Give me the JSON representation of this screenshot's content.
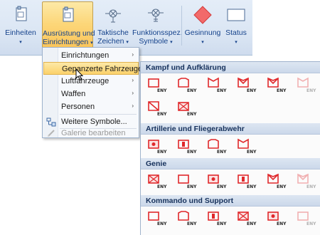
{
  "ribbon": {
    "buttons": [
      {
        "id": "einheiten",
        "line1": "Einheiten",
        "line2": "",
        "arrow": "▾",
        "icon": "folder-icon"
      },
      {
        "id": "ausruestung",
        "line1": "Ausrüstung und",
        "line2": "Einrichtungen",
        "arrow": "▾",
        "icon": "folder-icon"
      },
      {
        "id": "taktische",
        "line1": "Taktische",
        "line2": "Zeichen",
        "arrow": "▾",
        "icon": "tactical-sign-icon"
      },
      {
        "id": "funktionsspez",
        "line1": "Funktionsspez.",
        "line2": "Symbole",
        "arrow": "▾",
        "icon": "function-symbol-icon"
      },
      {
        "id": "gesinnung",
        "line1": "Gesinnung",
        "line2": "",
        "arrow": "▾",
        "icon": "red-diamond-icon"
      },
      {
        "id": "status",
        "line1": "Status",
        "line2": "",
        "arrow": "▾",
        "icon": "rectangle-icon"
      }
    ]
  },
  "menu": {
    "items": [
      {
        "label": "Einrichtungen",
        "submenu": "›"
      },
      {
        "label": "Gepanzerte Fahrzeuge",
        "submenu": "›",
        "selected": true
      },
      {
        "label": "Luftfahrzeuge",
        "submenu": "›"
      },
      {
        "label": "Waffen",
        "submenu": "›"
      },
      {
        "label": "Personen",
        "submenu": "›"
      },
      {
        "label": "Weitere Symbole...",
        "icon": "symbols-icon"
      },
      {
        "label": "Galerie bearbeiten",
        "icon": "edit-pencil-icon",
        "disabled": true
      }
    ]
  },
  "gallery": {
    "sections": [
      {
        "title": "Kampf und Aufklärung",
        "rows": 2,
        "count": 8
      },
      {
        "title": "Artillerie und Fliegerabwehr",
        "rows": 1,
        "count": 4
      },
      {
        "title": "Genie",
        "rows": 1,
        "count": 6
      },
      {
        "title": "Kommando und Support",
        "rows": 1,
        "count": 6
      }
    ],
    "label": "ENY"
  },
  "colors": {
    "symbol_red": "#e0282b",
    "symbol_fill": "#fbe2e2",
    "highlight": "#fbd16a"
  }
}
